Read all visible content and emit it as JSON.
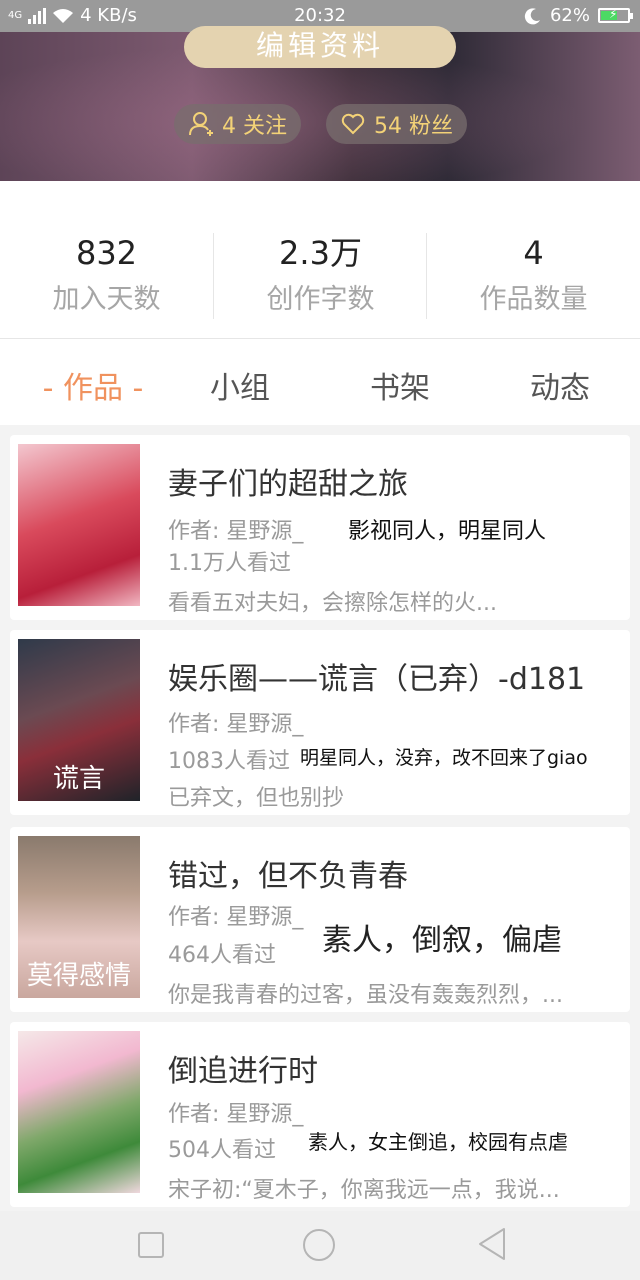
{
  "status_bar": {
    "network": "4G",
    "speed": "4 KB/s",
    "time": "20:32",
    "battery": "62%",
    "battery_level": 0.62
  },
  "profile": {
    "edit_label": "编辑资料",
    "following_label": "4 关注",
    "fans_label": "54 粉丝"
  },
  "stats": [
    {
      "value": "832",
      "label": "加入天数"
    },
    {
      "value": "2.3万",
      "label": "创作字数"
    },
    {
      "value": "4",
      "label": "作品数量"
    }
  ],
  "tabs": [
    {
      "label": "- 作品 -",
      "active": true
    },
    {
      "label": "小组",
      "active": false
    },
    {
      "label": "书架",
      "active": false
    },
    {
      "label": "动态",
      "active": false
    }
  ],
  "works": [
    {
      "title": "妻子们的超甜之旅",
      "author": "作者: 星野源_",
      "views": "1.1万人看过",
      "summary": "看看五对夫妇，会擦除怎样的火...",
      "tag": "影视同人，明星同人",
      "cover_text": ""
    },
    {
      "title": "娱乐圈——谎言（已弃）-d181",
      "author": "作者: 星野源_",
      "views": "1083人看过",
      "summary": "已弃文，但也别抄",
      "tag": "明星同人，没弃，改不回来了giao",
      "cover_text": "谎言"
    },
    {
      "title": "错过，但不负青春",
      "author": "作者: 星野源_",
      "views": "464人看过",
      "summary": "你是我青春的过客，虽没有轰轰烈烈，...",
      "tag": "素人，倒叙，偏虐",
      "cover_text": "莫得感情"
    },
    {
      "title": "倒追进行时",
      "author": "作者: 星野源_",
      "views": "504人看过",
      "summary": "宋子初:“夏木子，你离我远一点，我说...",
      "tag": "素人，女主倒追，校园有点虐",
      "cover_text": ""
    }
  ],
  "colors": {
    "accent": "#f0925e",
    "gold": "#f3d277"
  }
}
